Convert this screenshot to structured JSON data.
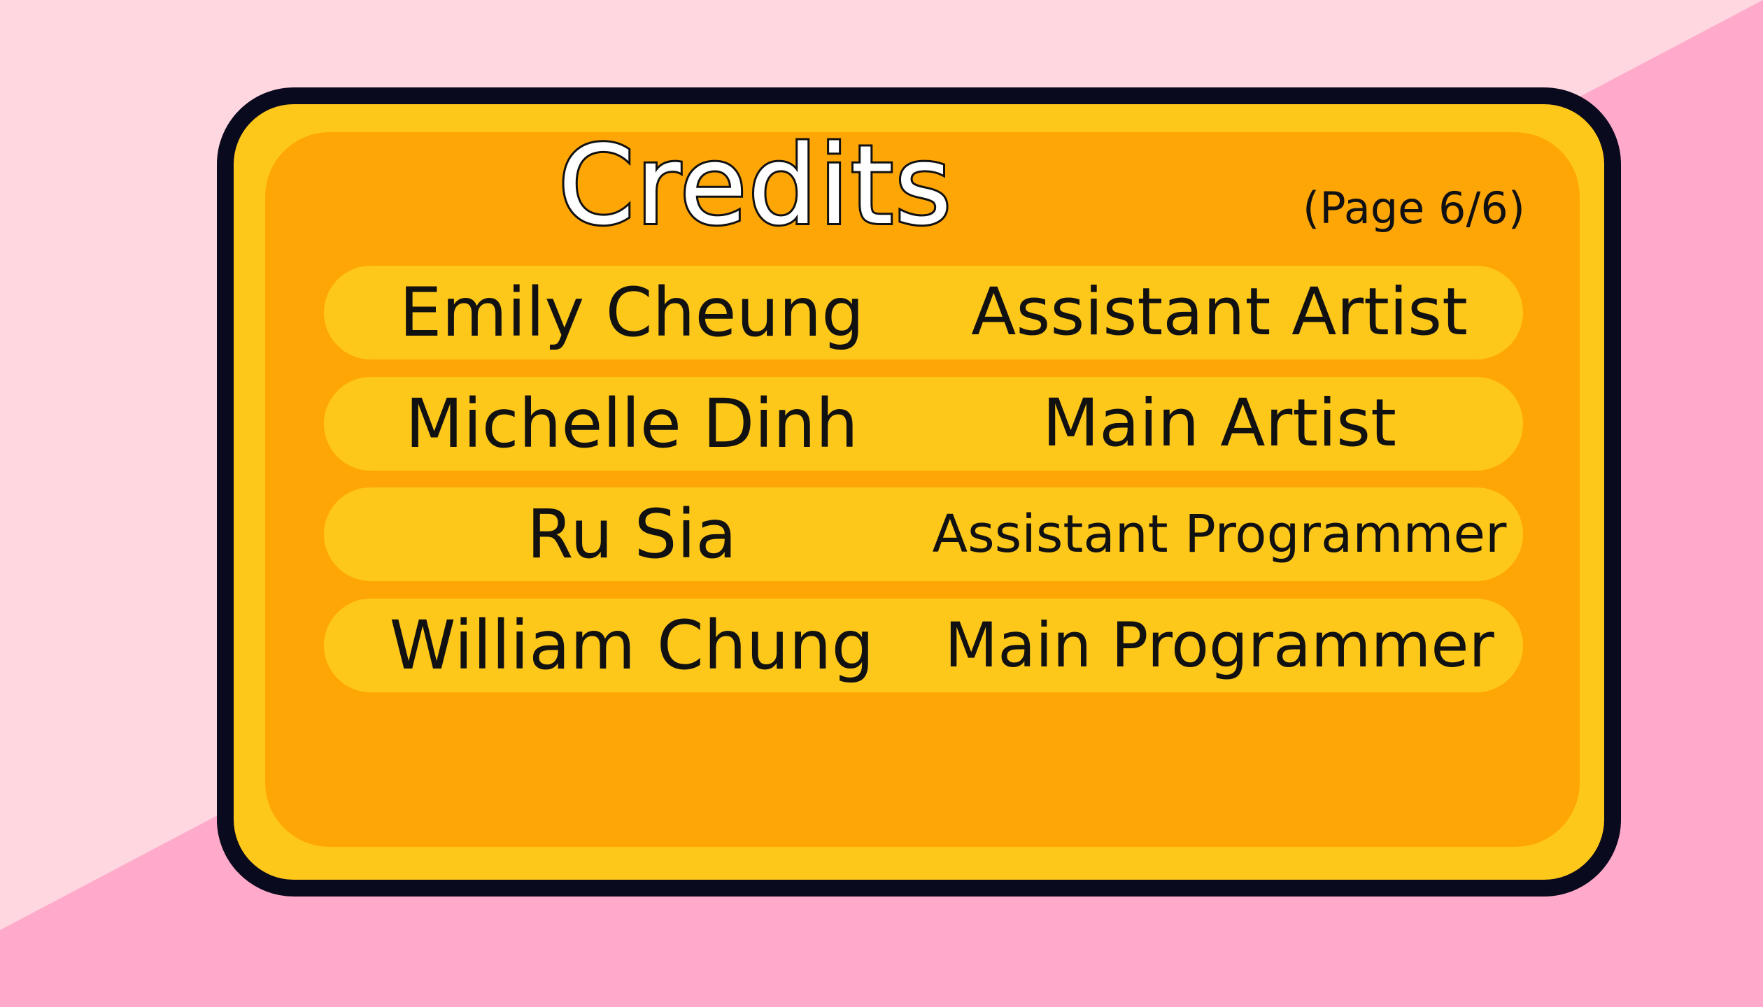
{
  "colors": {
    "background_light": "#FFD7E0",
    "background_dark": "#FFAACA",
    "panel_border": "#0A0A1E",
    "panel_outer": "#FEC81B",
    "panel_inner": "#FFA607",
    "row_fill": "#FEC81B",
    "text": "#111111"
  },
  "header": {
    "title": "Credits",
    "page_indicator": "(Page 6/6)"
  },
  "credits": [
    {
      "name": "Emily Cheung",
      "role": "Assistant Artist"
    },
    {
      "name": "Michelle Dinh",
      "role": "Main Artist"
    },
    {
      "name": "Ru Sia",
      "role": "Assistant Programmer"
    },
    {
      "name": "William Chung",
      "role": "Main Programmer"
    }
  ]
}
